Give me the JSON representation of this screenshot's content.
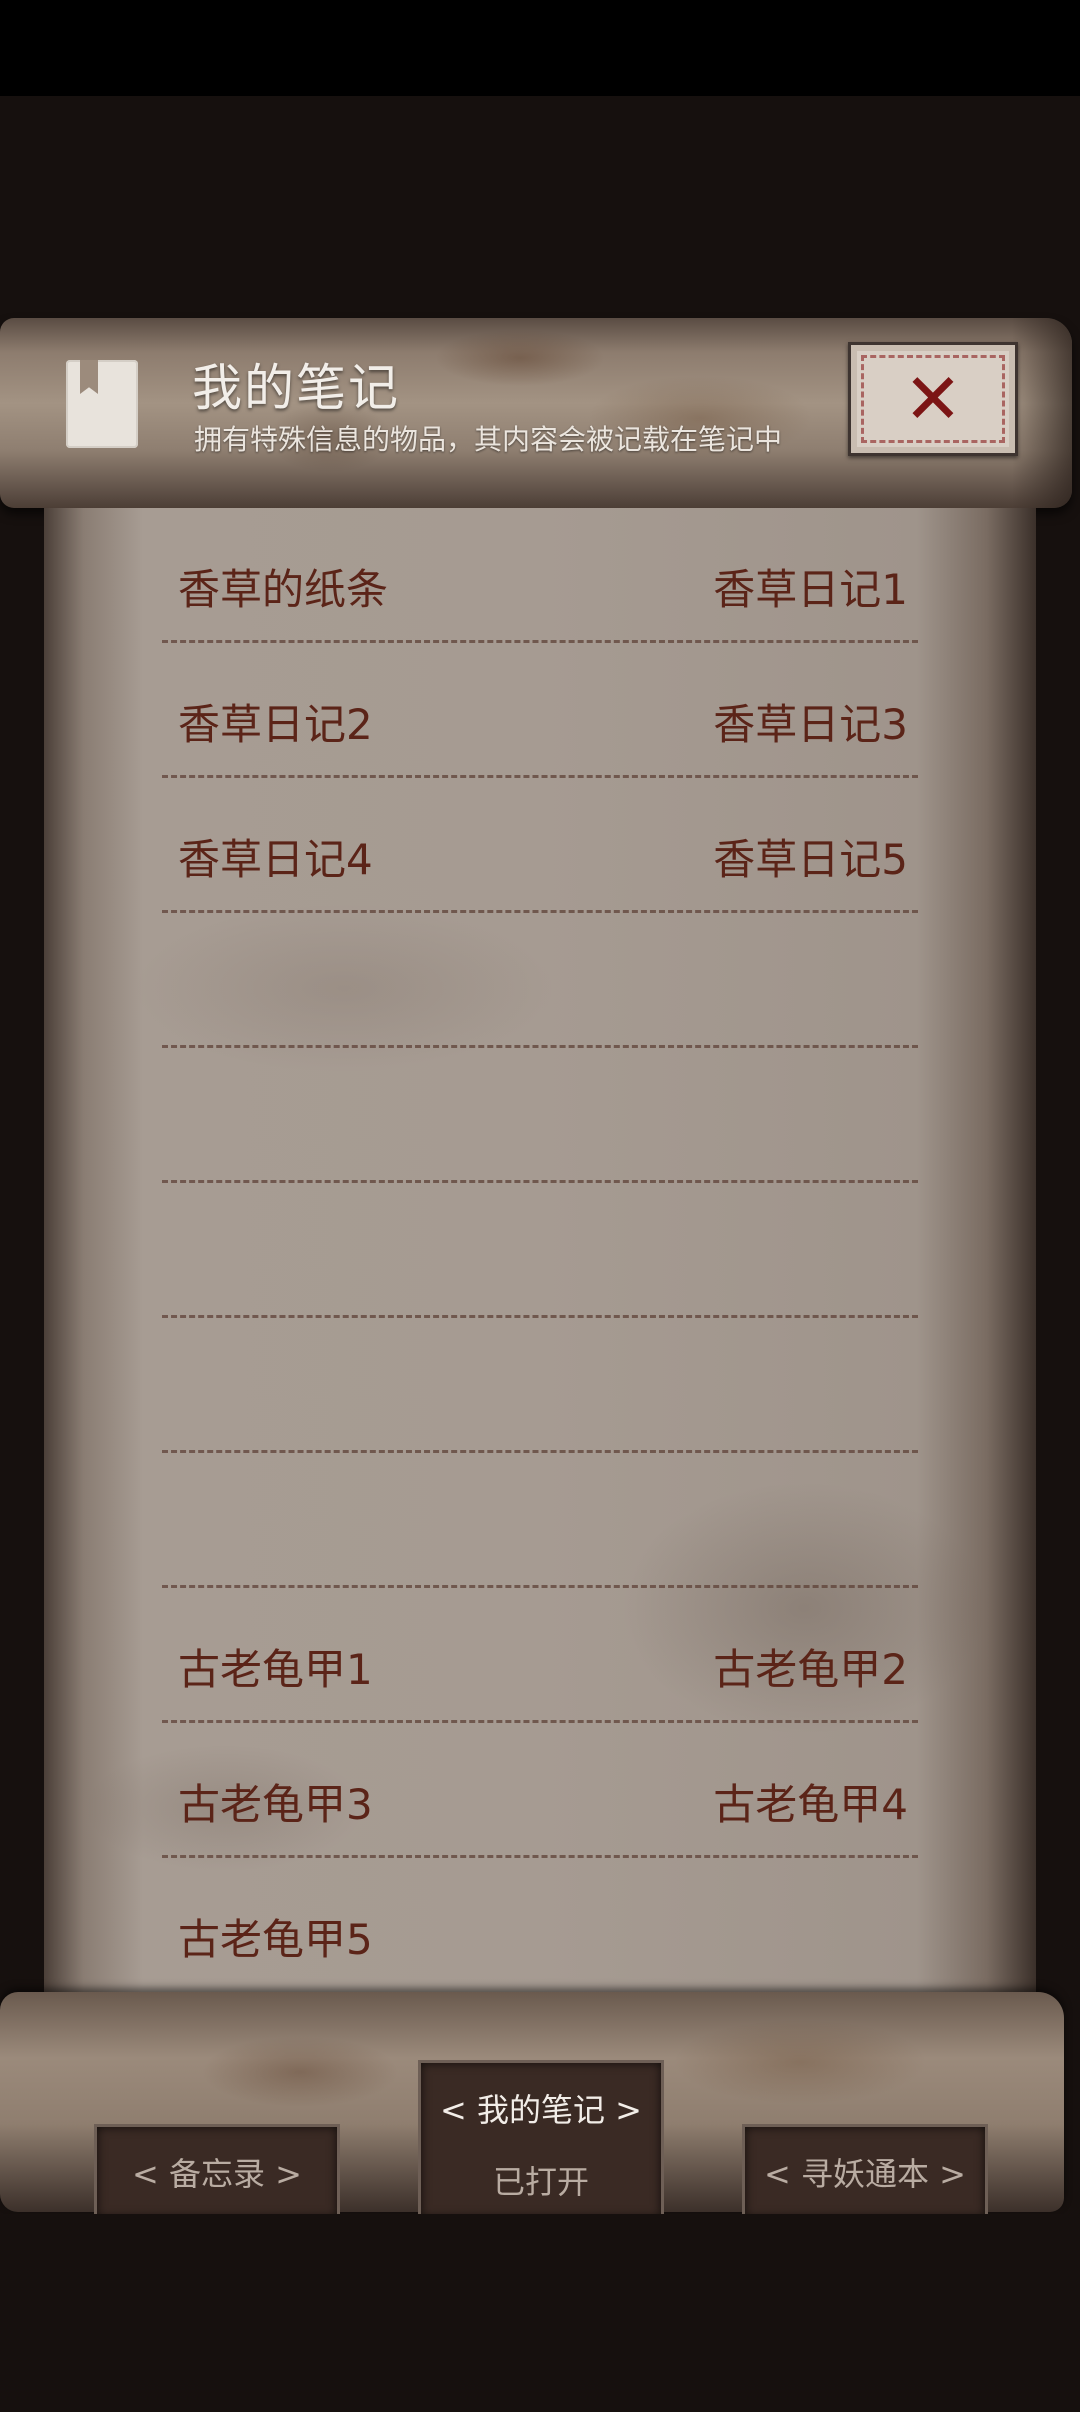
{
  "header": {
    "title": "我的笔记",
    "subtitle": "拥有特殊信息的物品，其内容会被记载在笔记中",
    "close_icon": "close-x-icon",
    "book_icon": "book-bookmark-icon"
  },
  "notes": {
    "rows": [
      {
        "left": "香草的纸条",
        "right": "香草日记1"
      },
      {
        "left": "香草日记2",
        "right": "香草日记3"
      },
      {
        "left": "香草日记4",
        "right": "香草日记5"
      },
      {
        "left": "",
        "right": ""
      },
      {
        "left": "",
        "right": ""
      },
      {
        "left": "",
        "right": ""
      },
      {
        "left": "",
        "right": ""
      },
      {
        "left": "",
        "right": ""
      },
      {
        "left": "古老龟甲1",
        "right": "古老龟甲2"
      },
      {
        "left": "古老龟甲3",
        "right": "古老龟甲4"
      },
      {
        "left": "古老龟甲5",
        "right": ""
      }
    ]
  },
  "tabs": {
    "memo": "< 备忘录 >",
    "notes": "< 我的笔记 >",
    "notes_state": "已打开",
    "yao": "< 寻妖通本 >"
  },
  "colors": {
    "ink": "#5b2418",
    "paper": "#a69b92",
    "background": "#16100e"
  }
}
